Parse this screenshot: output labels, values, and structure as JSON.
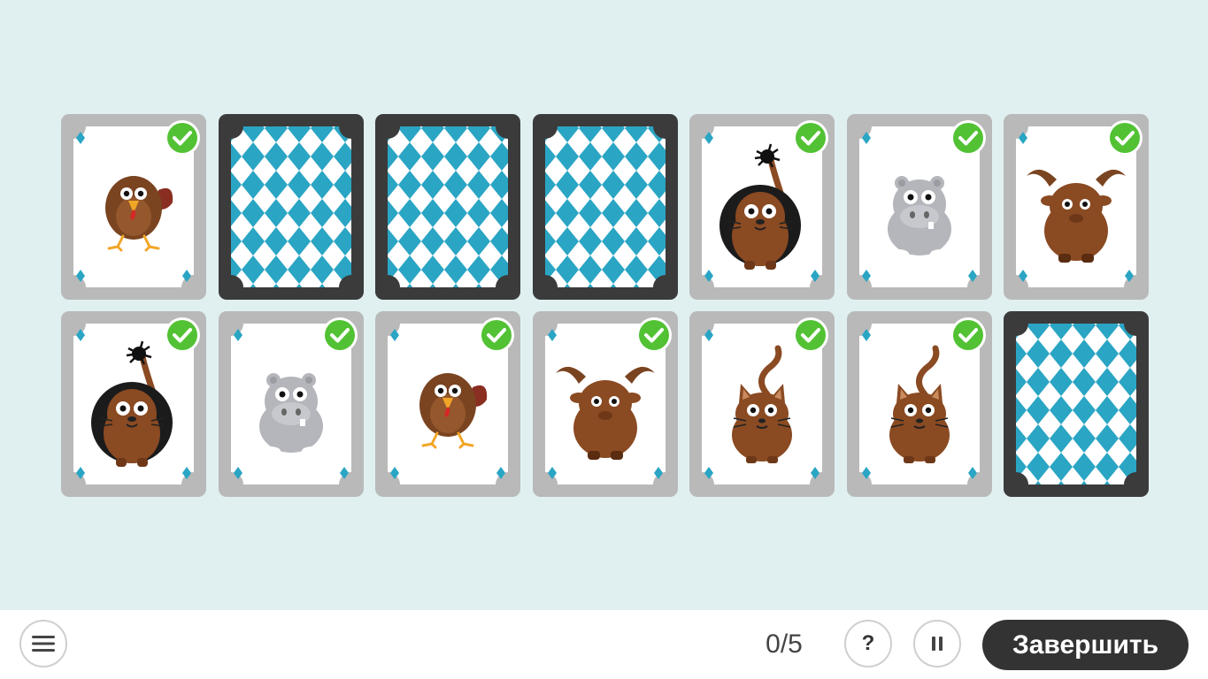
{
  "colors": {
    "board_background": "#e0f0f1",
    "pattern_blue": "#2aa5c4",
    "card_back_frame": "#3b3b3b",
    "card_front_frame": "#b9b9b9",
    "check_green": "#52c234",
    "finish_button": "#333333"
  },
  "cards": [
    {
      "animal": "turkey",
      "state": "matched"
    },
    {
      "animal": null,
      "state": "face-down"
    },
    {
      "animal": null,
      "state": "face-down"
    },
    {
      "animal": null,
      "state": "face-down"
    },
    {
      "animal": "lion",
      "state": "matched"
    },
    {
      "animal": "hippo",
      "state": "matched"
    },
    {
      "animal": "goat",
      "state": "matched"
    },
    {
      "animal": "lion",
      "state": "matched"
    },
    {
      "animal": "hippo",
      "state": "matched"
    },
    {
      "animal": "turkey",
      "state": "matched"
    },
    {
      "animal": "goat",
      "state": "matched"
    },
    {
      "animal": "cat",
      "state": "matched"
    },
    {
      "animal": "cat",
      "state": "matched"
    },
    {
      "animal": null,
      "state": "face-down"
    }
  ],
  "toolbar": {
    "menu_icon": "hamburger-menu-icon",
    "score": "0/5",
    "help_label": "?",
    "pause_icon": "pause-icon",
    "finish_label": "Завершить"
  }
}
